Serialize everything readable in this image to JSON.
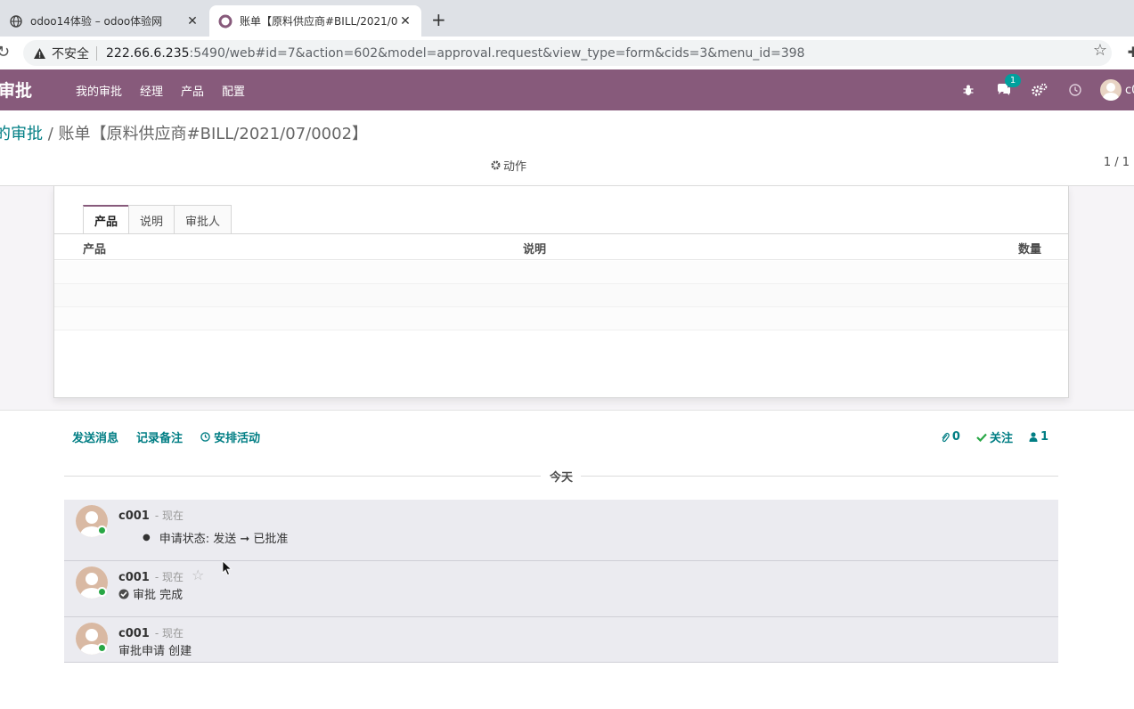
{
  "browser": {
    "tabs": [
      {
        "title": "odoo14体验 – odoo体验网",
        "active": false
      },
      {
        "title": "账单【原料供应商#BILL/2021/0",
        "active": true
      }
    ],
    "new_tab_label": "+",
    "close_label": "✕",
    "insecure_label": "不安全",
    "url_host": "222.66.6.235",
    "url_rest": ":5490/web#id=7&action=602&model=approval.request&view_type=form&cids=3&menu_id=398"
  },
  "navbar": {
    "brand": "审批",
    "menu": [
      "我的审批",
      "经理",
      "产品",
      "配置"
    ],
    "message_badge": "1",
    "user_initial": "c0"
  },
  "control_panel": {
    "breadcrumb_parent": "的审批",
    "breadcrumb_separator": " / ",
    "breadcrumb_current": "账单【原料供应商#BILL/2021/07/0002】",
    "action_label": "动作",
    "pager": "1 / 1"
  },
  "form": {
    "tabs": [
      "产品",
      "说明",
      "审批人"
    ],
    "active_tab": 0,
    "columns": {
      "product": "产品",
      "description": "说明",
      "quantity": "数量"
    }
  },
  "chatter": {
    "send_message": "发送消息",
    "log_note": "记录备注",
    "schedule_activity": "安排活动",
    "attachments_count": "0",
    "follow_label": "关注",
    "followers_count": "1",
    "date_separator": "今天",
    "messages": [
      {
        "author": "c001",
        "when": "- 现在",
        "tracking": "申请状态: 发送 ➞ 已批准"
      },
      {
        "author": "c001",
        "when": "- 现在",
        "body": "审批 完成"
      },
      {
        "author": "c001",
        "when": "- 现在",
        "body": "审批申请 创建"
      }
    ]
  },
  "colors": {
    "navbar": "#875a7b",
    "link": "#017e84",
    "badge": "#00a09d",
    "presence": "#28a745"
  }
}
